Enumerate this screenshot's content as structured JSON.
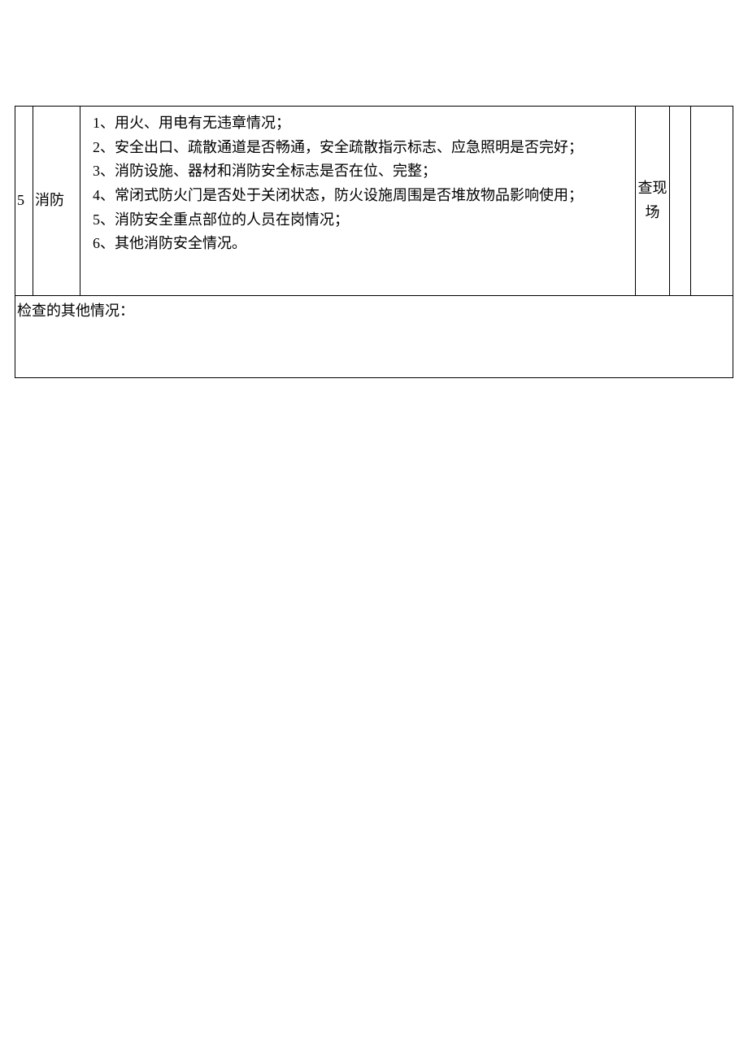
{
  "row": {
    "num": "5",
    "category": "消防",
    "items": [
      "1、用火、用电有无违章情况；",
      "2、安全出口、疏散通道是否畅通，安全疏散指示标志、应急照明是否完好；",
      "3、消防设施、器材和消防安全标志是否在位、完整；",
      "4、常闭式防火门是否处于关闭状态，防火设施周围是否堆放物品影响使用；",
      "5、消防安全重点部位的人员在岗情况；",
      "6、其他消防安全情况。"
    ],
    "method": "查现场"
  },
  "other_label": "检查的其他情况："
}
